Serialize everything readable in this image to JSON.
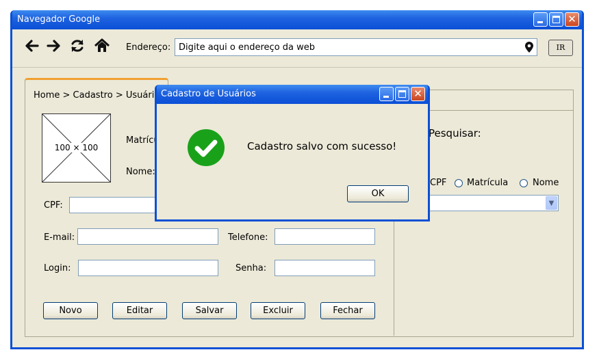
{
  "window": {
    "title": "Navegador Google"
  },
  "toolbar": {
    "address_label": "Endereço:",
    "address_value": "Digite aqui o endereço da web",
    "go_label": "IR"
  },
  "page": {
    "breadcrumb": "Home > Cadastro > Usuário:",
    "image_placeholder": "100 × 100",
    "labels": {
      "matricula": "Matrícula:",
      "nome": "Nome:",
      "cpf": "CPF:",
      "email": "E-mail:",
      "telefone": "Telefone:",
      "login": "Login:",
      "senha": "Senha:"
    },
    "buttons": {
      "novo": "Novo",
      "editar": "Editar",
      "salvar": "Salvar",
      "excluir": "Excluir",
      "fechar": "Fechar"
    },
    "search": {
      "title": "Pesquisar:",
      "options": [
        "CPF",
        "Matrícula",
        "Nome"
      ]
    }
  },
  "dialog": {
    "title": "Cadastro de Usuários",
    "message": "Cadastro salvo com sucesso!",
    "ok_label": "OK"
  },
  "colors": {
    "titlebar": "#0a4fd6",
    "window_bg": "#ece9d8",
    "success_green": "#1aa11a",
    "tab_accent": "#f0a030"
  }
}
